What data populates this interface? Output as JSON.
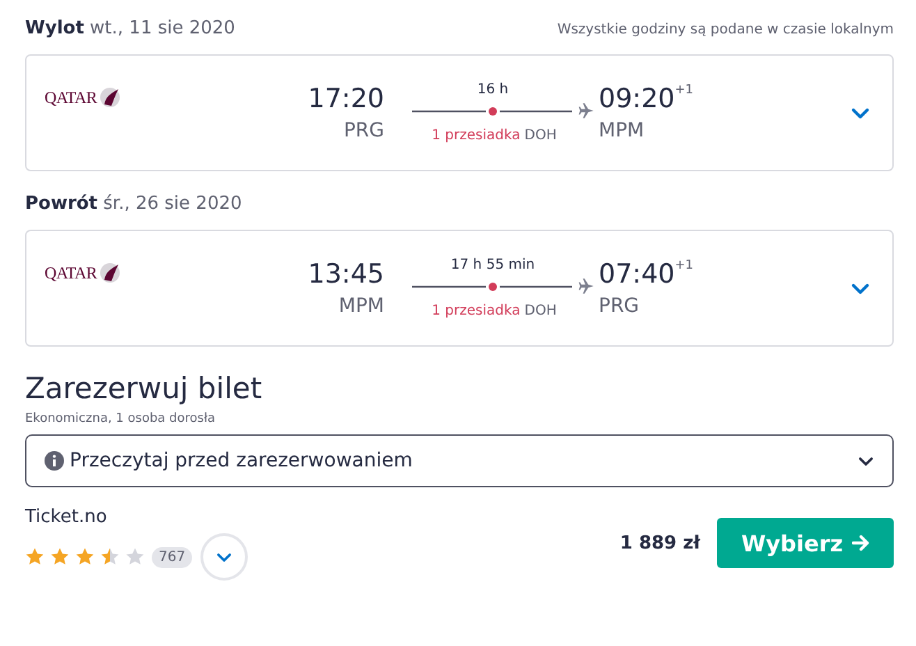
{
  "legs": [
    {
      "label": "Wylot",
      "date": "wt., 11 sie 2020",
      "note": "Wszystkie godziny są podane w czasie lokalnym",
      "airline_logo": "QATAR",
      "depart_time": "17:20",
      "depart_airport": "PRG",
      "duration": "16 h",
      "stops": "1 przesiadka",
      "stop_airport": "DOH",
      "arrive_time": "09:20",
      "day_offset": "+1",
      "arrive_airport": "MPM"
    },
    {
      "label": "Powrót",
      "date": "śr., 26 sie 2020",
      "airline_logo": "QATAR",
      "depart_time": "13:45",
      "depart_airport": "MPM",
      "duration": "17 h 55 min",
      "stops": "1 przesiadka",
      "stop_airport": "DOH",
      "arrive_time": "07:40",
      "day_offset": "+1",
      "arrive_airport": "PRG"
    }
  ],
  "booking": {
    "title": "Zarezerwuj bilet",
    "subtitle": "Ekonomiczna, 1 osoba dorosła",
    "notice": "Przeczytaj przed zarezerwowaniem",
    "provider": "Ticket.no",
    "stars": 3.5,
    "reviews": "767",
    "price": "1 889 zł",
    "button": "Wybierz"
  }
}
